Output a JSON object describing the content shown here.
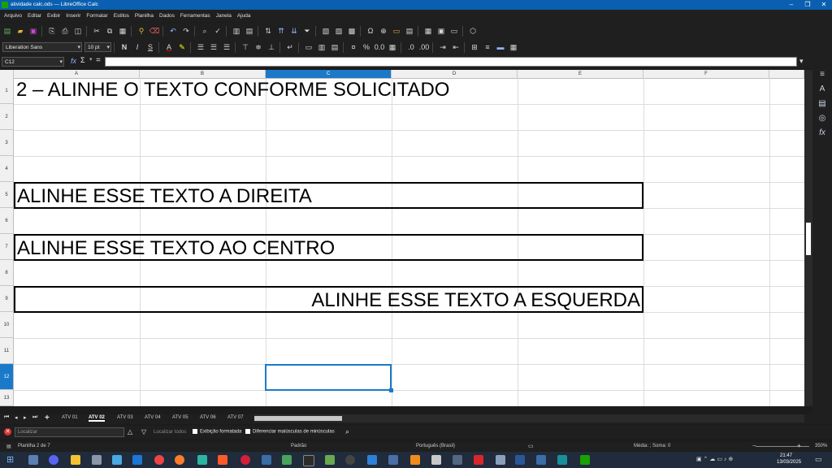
{
  "window": {
    "title": "atividade calc.ods — LibreOffice Calc"
  },
  "menu": [
    "Arquivo",
    "Editar",
    "Exibir",
    "Inserir",
    "Formatar",
    "Estilos",
    "Planilha",
    "Dados",
    "Ferramentas",
    "Janela",
    "Ajuda"
  ],
  "format_toolbar": {
    "font_name": "Liberation Sans",
    "font_size": "10 pt",
    "bold": "N",
    "italic": "I",
    "underline": "S"
  },
  "formula_bar": {
    "cell_ref": "C12",
    "fx": "fx",
    "sum": "Σ",
    "equals": "="
  },
  "columns": [
    "A",
    "B",
    "C",
    "D",
    "E",
    "F"
  ],
  "active_column": "C",
  "rows": [
    "1",
    "2",
    "3",
    "4",
    "5",
    "6",
    "7",
    "8",
    "9",
    "10",
    "11",
    "12",
    "13"
  ],
  "active_row": "12",
  "cells": {
    "title": "2 – ALINHE O TEXTO CONFORME SOLICITADO",
    "r5": "ALINHE ESSE TEXTO A DIREITA",
    "r7": "ALINHE ESSE TEXTO AO CENTRO",
    "r9": "ALINHE ESSE TEXTO A ESQUERDA"
  },
  "sheet_tabs": [
    "ATV 01",
    "ATV 02",
    "ATV 03",
    "ATV 04",
    "ATV 05",
    "ATV 06",
    "ATV 07"
  ],
  "active_tab": "ATV 02",
  "find_bar": {
    "placeholder": "Localizar",
    "find_all": "Localizar todos",
    "formatted": "Exibição formatada",
    "match_case": "Diferenciar maiúsculas de minúsculas"
  },
  "status": {
    "sheet": "Planilha 2 de 7",
    "style": "Padrão",
    "language": "Português (Brasil)",
    "summary": "Média: ; Soma: 0",
    "zoom": "350%"
  },
  "clock": {
    "time": "21:47",
    "date": "13/03/2025"
  }
}
